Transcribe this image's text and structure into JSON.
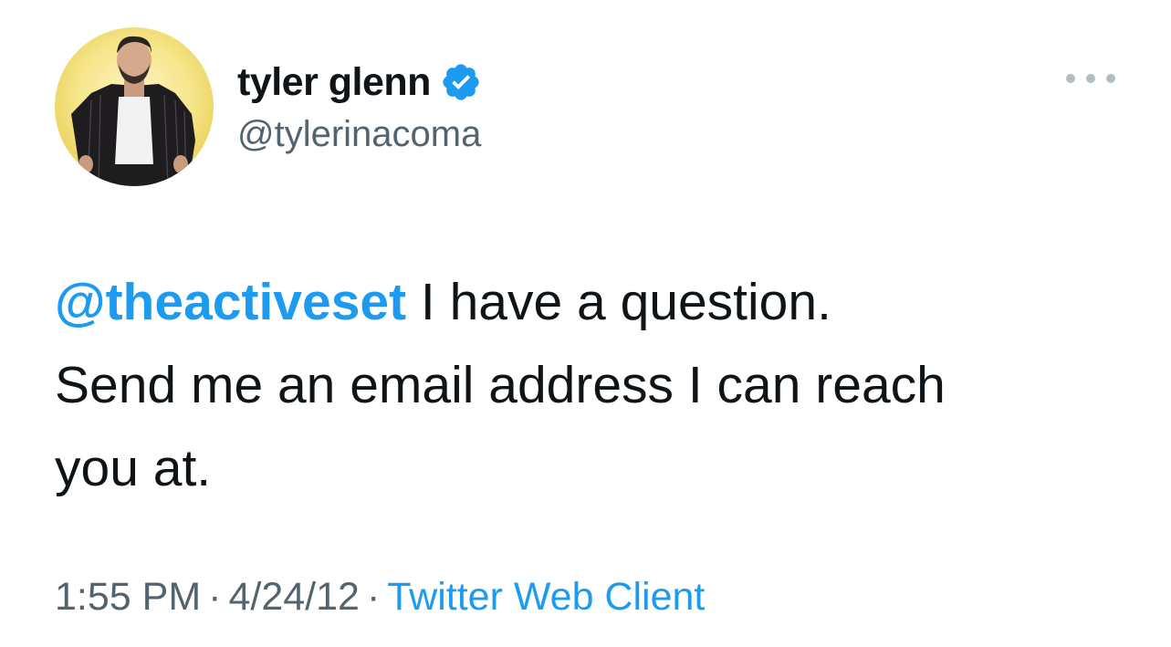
{
  "tweet": {
    "author": {
      "display_name": "tyler glenn",
      "handle": "@tylerinacoma",
      "verified": true,
      "avatar_icon": "profile-photo"
    },
    "more_icon": "more-options-icon",
    "text": {
      "mention": "@theactiveset",
      "line1_rest": " I have a question.",
      "line2": "Send me an email address I can reach",
      "line3": "you at."
    },
    "meta": {
      "time": "1:55 PM",
      "separator": "·",
      "date": "4/24/12",
      "source": "Twitter Web Client"
    }
  },
  "colors": {
    "link": "#1d9bf0",
    "text": "#0f1419",
    "secondary": "#536471",
    "verified": "#1d9bf0",
    "background": "#ffffff"
  }
}
